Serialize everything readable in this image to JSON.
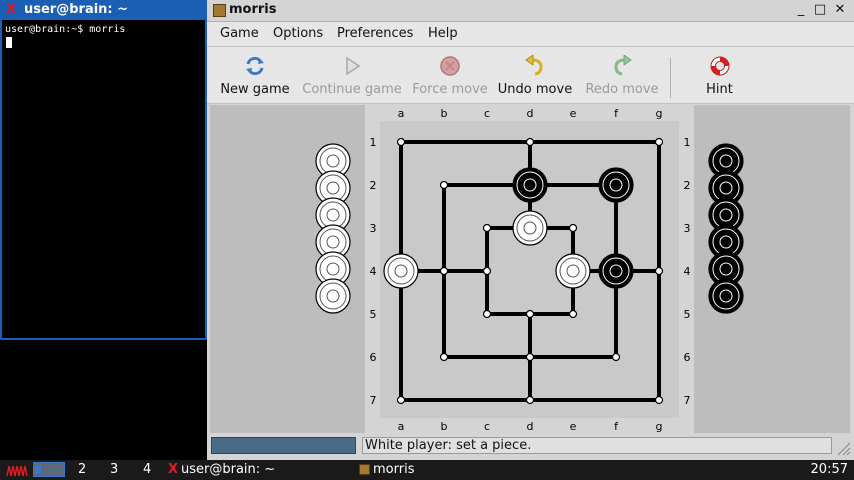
{
  "terminal": {
    "title": "user@brain: ~",
    "prompt_line": "user@brain:~$ morris"
  },
  "morris": {
    "title": "morris",
    "window_controls": {
      "minimize": "_",
      "maximize": "□",
      "close": "✕"
    },
    "menu": [
      "Game",
      "Options",
      "Preferences",
      "Help"
    ],
    "toolbar": [
      {
        "label": "New game",
        "icon": "refresh-icon",
        "enabled": true
      },
      {
        "label": "Continue game",
        "icon": "play-icon",
        "enabled": false
      },
      {
        "label": "Force move",
        "icon": "stop-icon",
        "enabled": false
      },
      {
        "label": "Undo move",
        "icon": "undo-arrow-icon",
        "enabled": true
      },
      {
        "label": "Redo move",
        "icon": "redo-arrow-icon",
        "enabled": false
      },
      {
        "label": "Hint",
        "icon": "lifebuoy-icon",
        "enabled": true
      }
    ],
    "board": {
      "columns": [
        "a",
        "b",
        "c",
        "d",
        "e",
        "f",
        "g"
      ],
      "rows": [
        "1",
        "2",
        "3",
        "4",
        "5",
        "6",
        "7"
      ],
      "white_pieces": [
        "d3",
        "a4",
        "e4"
      ],
      "black_pieces": [
        "d2",
        "f2",
        "f4"
      ],
      "white_reserve": 6,
      "black_reserve": 6
    },
    "status": "White player: set a piece."
  },
  "taskbar": {
    "workspaces": [
      "2",
      "3",
      "4"
    ],
    "tasks": [
      "user@brain: ~",
      "morris"
    ],
    "clock": "20:57"
  },
  "colors": {
    "terminal_accent": "#1a5fb4",
    "board_bg": "#bdbdbd",
    "board_inner": "#c9c9c9",
    "progress": "#4a6a88"
  }
}
